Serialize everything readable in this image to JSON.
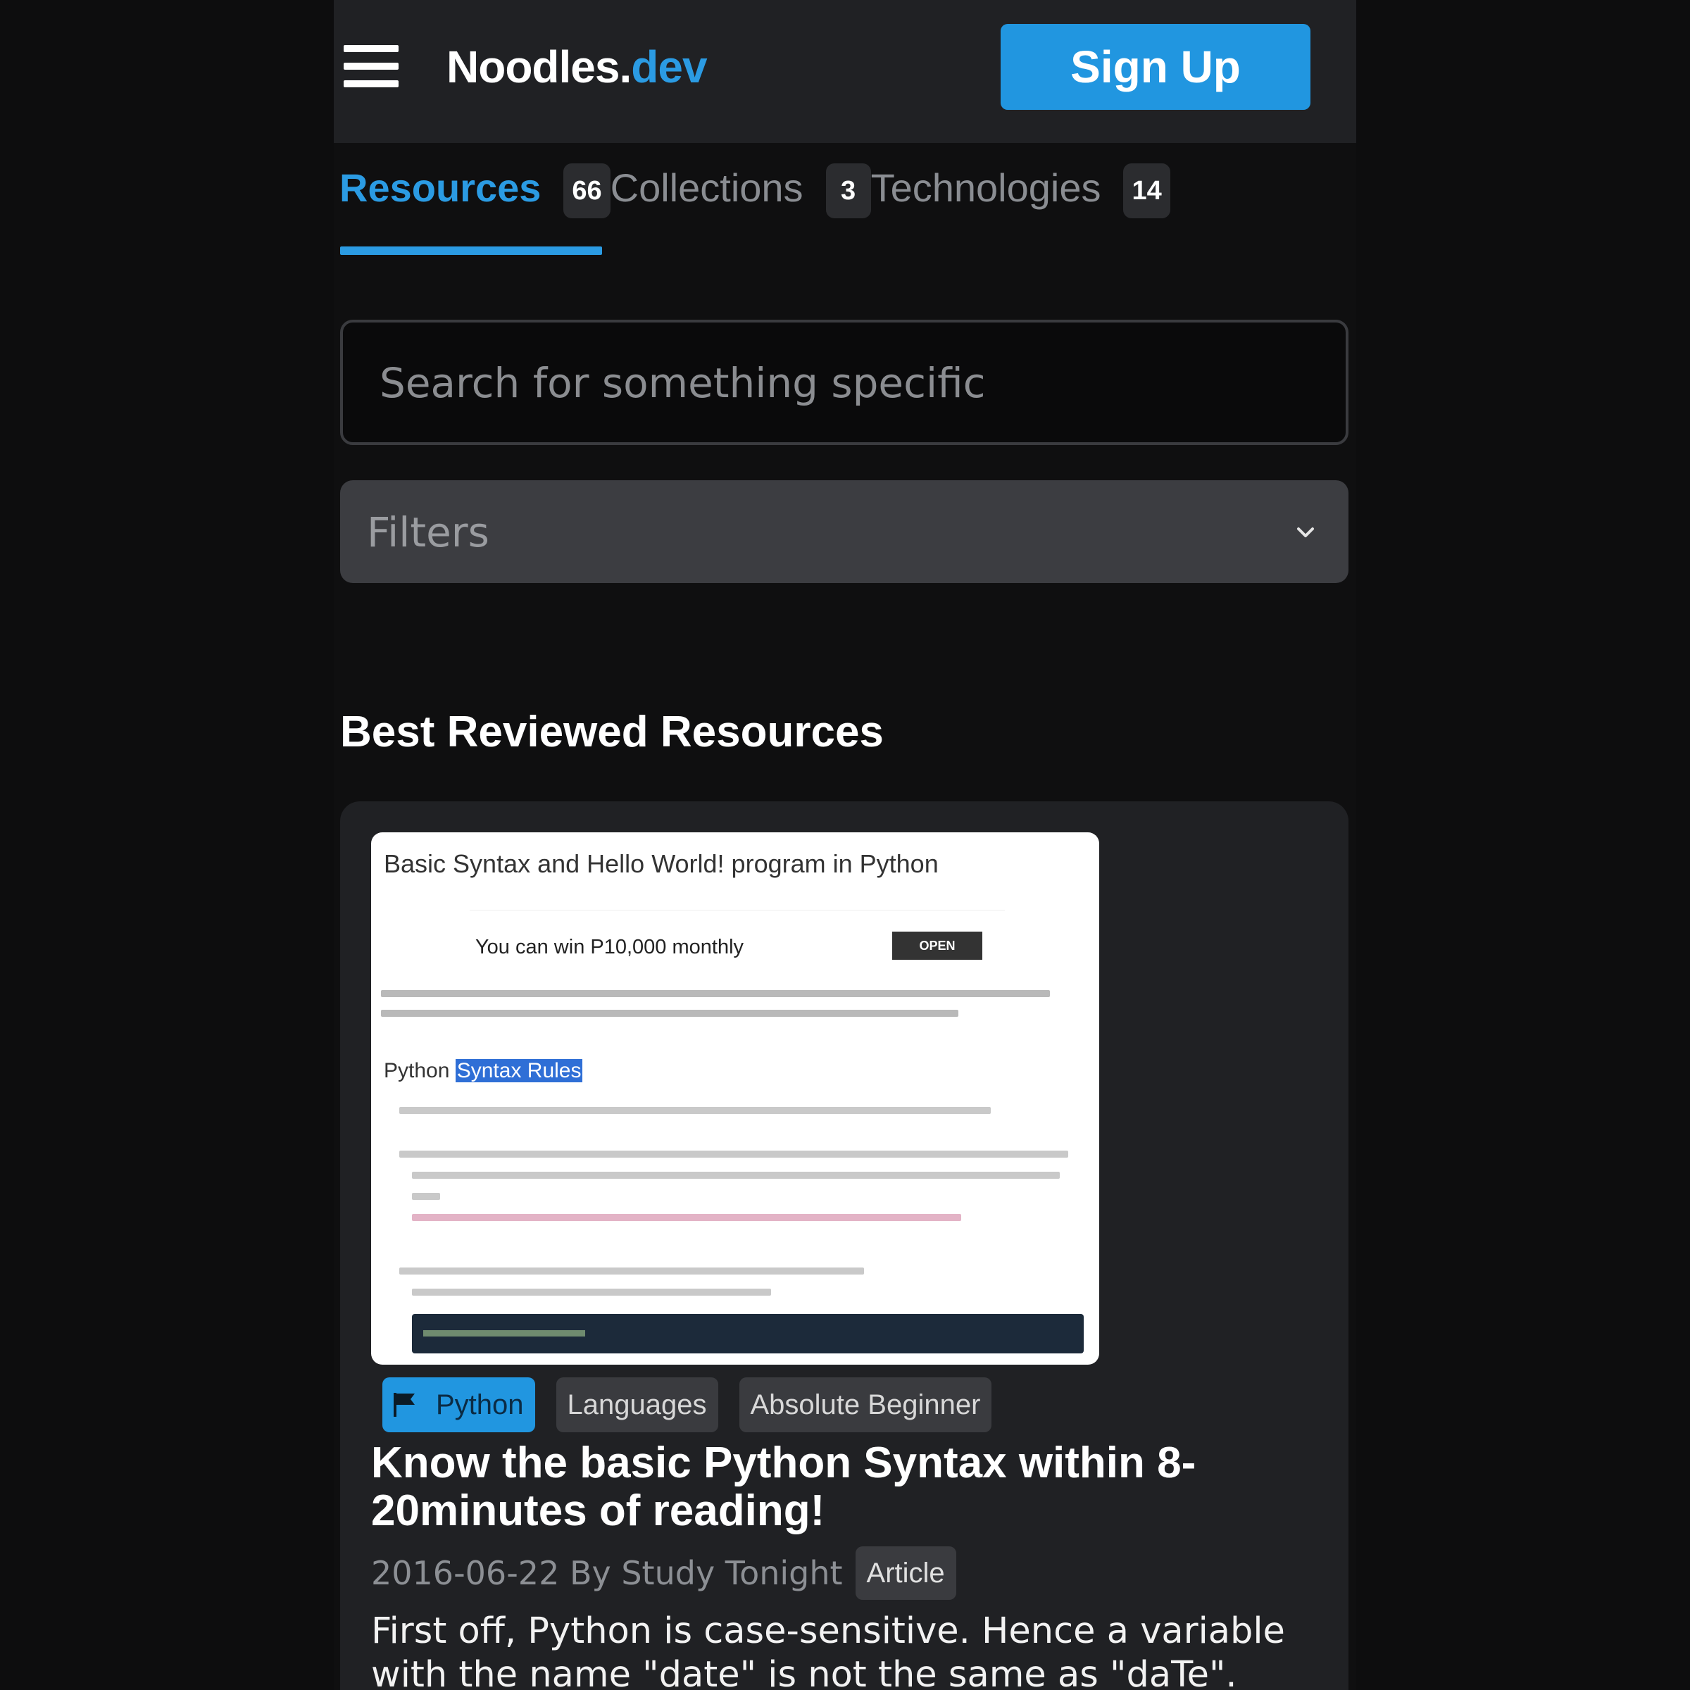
{
  "header": {
    "logo_main": "Noodles.",
    "logo_accent": "dev",
    "signup_label": "Sign Up"
  },
  "tabs": [
    {
      "label": "Resources",
      "count": "66",
      "active": true
    },
    {
      "label": "Collections",
      "count": "3",
      "active": false
    },
    {
      "label": "Technologies",
      "count": "14",
      "active": false
    }
  ],
  "search": {
    "placeholder": "Search for something specific",
    "value": ""
  },
  "filters": {
    "label": "Filters"
  },
  "section": {
    "title": "Best Reviewed Resources"
  },
  "card": {
    "thumbnail": {
      "page_title": "Basic Syntax and Hello World! program in Python",
      "ad_text": "You can win P10,000 monthly",
      "ad_button": "OPEN",
      "subheading_plain": "Python ",
      "subheading_highlight": "Syntax Rules"
    },
    "tags": [
      {
        "label": "Python",
        "icon": "flag-icon",
        "primary": true
      },
      {
        "label": "Languages",
        "primary": false
      },
      {
        "label": "Absolute Beginner",
        "primary": false
      }
    ],
    "title": "Know the basic Python Syntax within 8-20minutes of reading!",
    "meta": "2016-06-22 By Study Tonight",
    "type_badge": "Article",
    "description": "First off, Python is case-sensitive. Hence a variable with the name \"date\" is not the same as \"daTe\". This"
  },
  "colors": {
    "accent": "#2b9be3",
    "button": "#2196e0",
    "background": "#0f0f10",
    "surface": "#202124"
  }
}
